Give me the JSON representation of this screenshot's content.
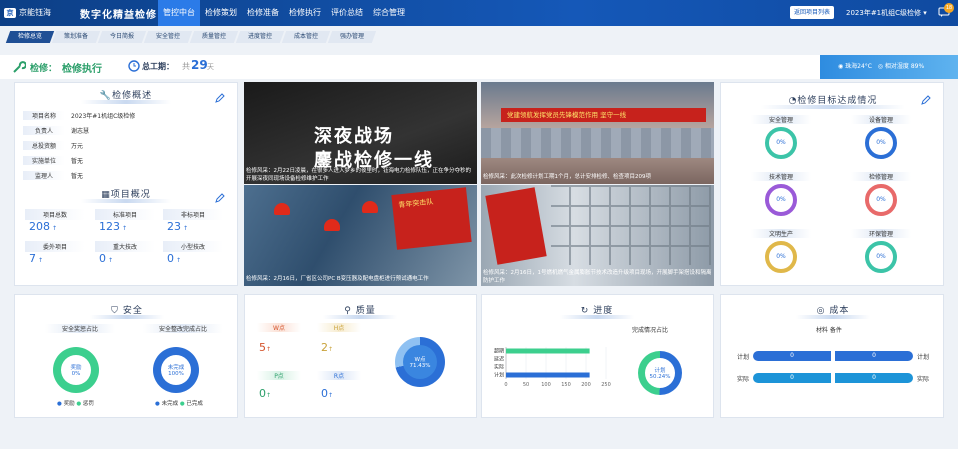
{
  "topbar": {
    "logo": "京能钰海",
    "system_name": "数字化精益检修",
    "nav": [
      "管控中台",
      "检修策划",
      "检修准备",
      "检修执行",
      "评价总结",
      "综合管理"
    ],
    "back_button": "返回项目列表",
    "project": "2023年#1机组C级检修",
    "msg_count": "18"
  },
  "tabs": [
    "检修总览",
    "策划准备",
    "今日简报",
    "安全管控",
    "质量管控",
    "进度管控",
    "成本管控",
    "强办管理"
  ],
  "status": {
    "label": "检修：",
    "stage": "检修执行",
    "total_label": "总工期：",
    "total_prefix": "共",
    "total_days": "29",
    "total_unit": "天",
    "temperature": "珠海24°C",
    "humidity": "相对湿度 89%"
  },
  "overview": {
    "title": "检修概述",
    "rows": [
      {
        "k": "项目名称",
        "v": "2023年#1机组C级检修"
      },
      {
        "k": "负责人",
        "v": "谢志慧"
      },
      {
        "k": "总投资额",
        "v": "万元"
      },
      {
        "k": "实施单位",
        "v": "暂无"
      },
      {
        "k": "监理人",
        "v": "暂无"
      }
    ]
  },
  "project_overview": {
    "title": "项目概况",
    "stats": [
      {
        "label": "项目总数",
        "value": "208"
      },
      {
        "label": "标准项目",
        "value": "123"
      },
      {
        "label": "非标项目",
        "value": "23"
      },
      {
        "label": "委外项目",
        "value": "7"
      },
      {
        "label": "重大技改",
        "value": "0"
      },
      {
        "label": "小型技改",
        "value": "0"
      }
    ]
  },
  "photos": {
    "p1_title": "深夜战场",
    "p1_sub": "鏖战检修一线",
    "p1_cap": "检修风采：2月22日凌晨，在很多人进入梦乡的夜里时，钰海电力检修队伍，正在争分夺秒的开展深夜同现场设备检修维护工作",
    "p2_banner": "党建领航发挥党员先锋模范作用  坚守一线",
    "p2_cap": "检修风采：此次检修计划工期1个月，总计安排检修、检查项目209项",
    "p3_banner": "青年突击队",
    "p3_cap": "检修风采：2月16日，厂省区公司PC B变压器及配电盘柜进行预试通电工作",
    "p4_cap": "检修风采：2月16日，1号燃机燃气金属膨胀节技术改造升级项目现场，开展脚手架搭设和隔离防护工作"
  },
  "targets": {
    "title": "检修目标达成情况",
    "items": [
      {
        "label": "安全管理",
        "value": "0%",
        "color": "#3cc4a8"
      },
      {
        "label": "设备管理",
        "value": "0%",
        "color": "#2b6fd6"
      },
      {
        "label": "技术管理",
        "value": "0%",
        "color": "#9a5ad8"
      },
      {
        "label": "检修管理",
        "value": "0%",
        "color": "#e86a6a"
      },
      {
        "label": "文明生产",
        "value": "0%",
        "color": "#e0b84a"
      },
      {
        "label": "环保管理",
        "value": "0%",
        "color": "#3cc4a8"
      }
    ]
  },
  "safety": {
    "title": "安全",
    "c1_title": "安全奖惩占比",
    "c1_center_label": "奖励",
    "c1_center_value": "0%",
    "c1_legend": [
      "奖励",
      "惩罚"
    ],
    "c2_title": "安全整改完成占比",
    "c2_center_label": "未完成",
    "c2_center_value": "100%",
    "c2_legend": [
      "未完成",
      "已完成"
    ]
  },
  "quality": {
    "title": "质量",
    "points": [
      {
        "label": "W点",
        "value": "5"
      },
      {
        "label": "H点",
        "value": "2"
      },
      {
        "label": "P点",
        "value": "0"
      },
      {
        "label": "R点",
        "value": "0"
      }
    ],
    "ring_label": "W点",
    "ring_value": "71.43%"
  },
  "progress": {
    "title": "进度",
    "chart_title": "完成情况占比",
    "ring_label": "计划",
    "ring_value": "50.24%"
  },
  "cost": {
    "title": "成本",
    "subtitle": "材料 备件",
    "rows": [
      {
        "label": "计划",
        "left": "0",
        "right": "0",
        "right_label": "计划"
      },
      {
        "label": "实际",
        "left": "0",
        "right": "0",
        "right_label": "实际"
      }
    ]
  },
  "chart_data": {
    "type": "bar",
    "orientation": "horizontal",
    "categories": [
      "超期",
      "延迟",
      "实际",
      "计划"
    ],
    "values": [
      209,
      0,
      0,
      209
    ],
    "colors": [
      "#3ccf8e",
      "#3ccf8e",
      "#2b6fd6",
      "#2b6fd6"
    ],
    "xticks": [
      "0",
      "50",
      "100",
      "150",
      "200",
      "250"
    ],
    "xlim": [
      0,
      250
    ]
  }
}
